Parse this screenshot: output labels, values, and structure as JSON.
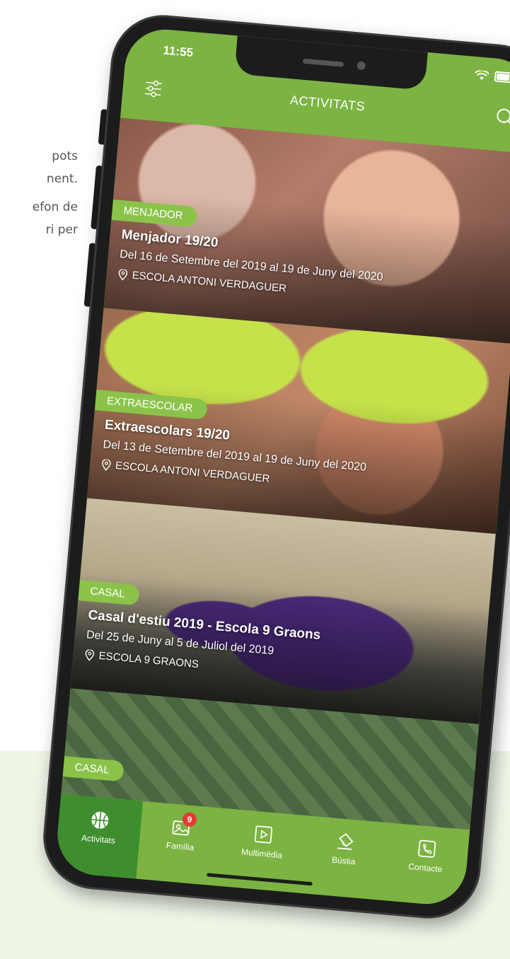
{
  "side_text": [
    "pots",
    "nent.",
    "efon de",
    "ri per"
  ],
  "status": {
    "time": "11:55"
  },
  "header": {
    "title": "ACTIVITATS",
    "filter_icon": "sliders-icon",
    "search_icon": "search-icon"
  },
  "cards": [
    {
      "tag": "MENJADOR",
      "title": "Menjador 19/20",
      "dates": "Del 16 de Setembre del 2019 al 19 de Juny del 2020",
      "location": "ESCOLA ANTONI VERDAGUER"
    },
    {
      "tag": "EXTRAESCOLAR",
      "title": "Extraescolars 19/20",
      "dates": "Del 13 de Setembre del 2019 al 19 de Juny del 2020",
      "location": "ESCOLA ANTONI VERDAGUER"
    },
    {
      "tag": "CASAL",
      "title": "Casal d'estiu 2019 - Escola 9 Graons",
      "dates": "Del 25 de Juny al 5 de Juliol del 2019",
      "location": "ESCOLA 9 GRAONS"
    },
    {
      "tag": "CASAL",
      "title": "",
      "dates": "",
      "location": ""
    }
  ],
  "tabs": [
    {
      "label": "Activitats",
      "icon": "basketball-icon",
      "active": true
    },
    {
      "label": "Família",
      "icon": "photos-icon",
      "badge": "9"
    },
    {
      "label": "Multimèdia",
      "icon": "play-icon"
    },
    {
      "label": "Bústia",
      "icon": "mailbox-icon"
    },
    {
      "label": "Contacte",
      "icon": "phone-icon"
    }
  ],
  "colors": {
    "brand_green": "#7cb342",
    "active_tab": "#3e8e30",
    "tag_green": "#8bc34a",
    "badge_red": "#e53935"
  }
}
